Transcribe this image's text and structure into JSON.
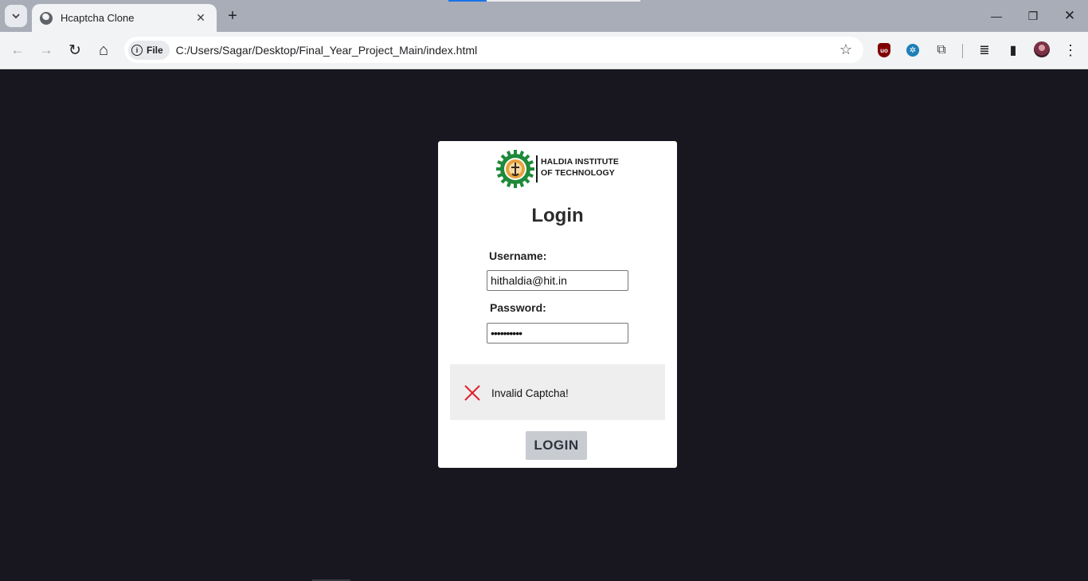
{
  "browser": {
    "tab": {
      "title": "Hcaptcha Clone",
      "close_glyph": "✕"
    },
    "new_tab_glyph": "+",
    "omnibox": {
      "chip_label": "File",
      "chip_icon": "i",
      "url": "C:/Users/Sagar/Desktop/Final_Year_Project_Main/index.html"
    },
    "nav": {
      "back": "←",
      "forward": "→",
      "reload": "↻",
      "home": "⌂"
    },
    "window_controls": {
      "minimize": "—",
      "restore": "❐",
      "close": "✕"
    },
    "extensions": [
      "ublock-origin-icon",
      "extension-blue-icon",
      "puzzle-extensions-icon"
    ],
    "extension_glyphs": {
      "ublock": "uo",
      "blue": "✲",
      "puzzle": "⧉"
    },
    "toolbar_icons": {
      "star": "☆",
      "media": "≣",
      "sidepanel": "▮",
      "menu": "⋮"
    }
  },
  "page": {
    "logo": {
      "line1": "HALDIA INSTITUTE",
      "line2": "OF TECHNOLOGY"
    },
    "title": "Login",
    "username": {
      "label": "Username:",
      "value": "hithaldia@hit.in"
    },
    "password": {
      "label": "Password:",
      "value": "••••••••••"
    },
    "captcha": {
      "message": "Invalid Captcha!",
      "status_color": "#e0202e"
    },
    "login_button": "LOGIN"
  },
  "colors": {
    "page_background": "#18161f",
    "card_background": "#ffffff",
    "logo_green": "#1e8a3a",
    "logo_gold": "#e8a23a"
  }
}
